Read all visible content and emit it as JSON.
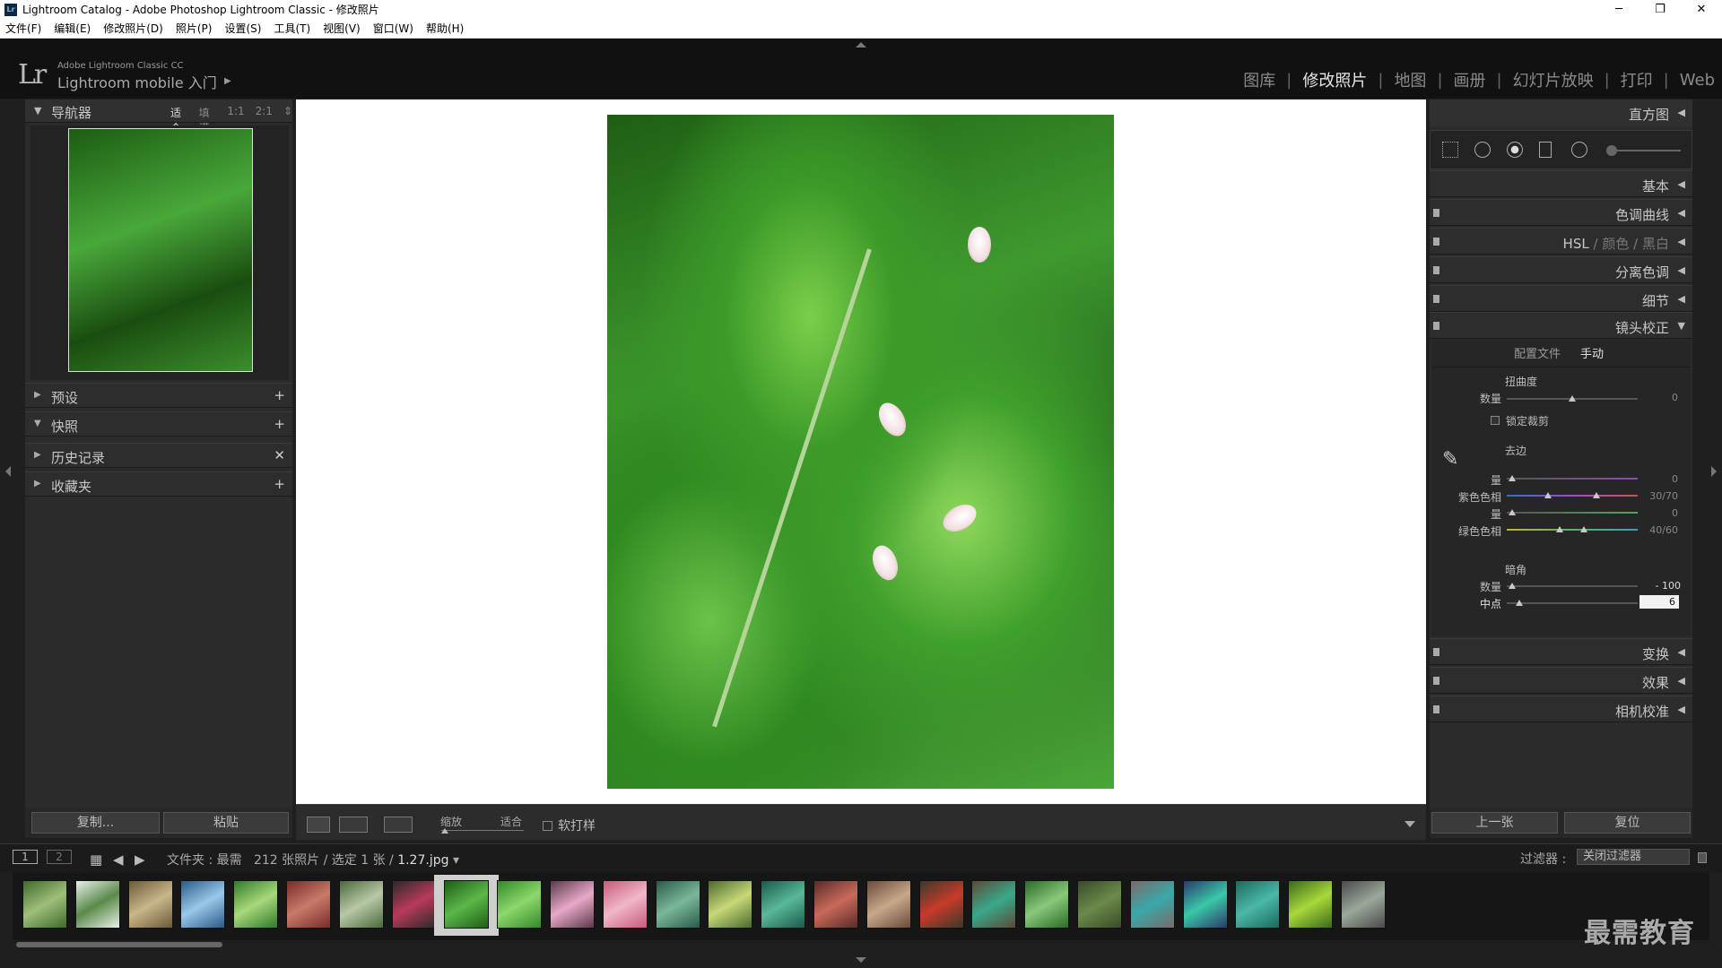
{
  "window": {
    "title": "Lightroom Catalog - Adobe Photoshop Lightroom Classic - 修改照片",
    "app_icon": "Lr",
    "minimize": "─",
    "restore": "❐",
    "close": "✕"
  },
  "menu": [
    "文件(F)",
    "编辑(E)",
    "修改照片(D)",
    "照片(P)",
    "设置(S)",
    "工具(T)",
    "视图(V)",
    "窗口(W)",
    "帮助(H)"
  ],
  "identity": {
    "logo": "Lr",
    "line1": "Adobe Lightroom Classic CC",
    "line2": "Lightroom mobile 入门",
    "arrow": "▶"
  },
  "modules": {
    "items": [
      "图库",
      "修改照片",
      "地图",
      "画册",
      "幻灯片放映",
      "打印",
      "Web"
    ],
    "active": "修改照片",
    "separator": "|"
  },
  "navigator": {
    "title": "导航器",
    "zooms": [
      "适合",
      "填满",
      "1:1",
      "2:1"
    ],
    "zoom_arrows": "⇕"
  },
  "left_panels": [
    {
      "label": "预设",
      "action": "+",
      "tri": "▶"
    },
    {
      "label": "快照",
      "action": "+",
      "tri": "▼"
    },
    {
      "label": "历史记录",
      "action": "✕",
      "tri": "▶"
    },
    {
      "label": "收藏夹",
      "action": "+",
      "tri": "▶"
    }
  ],
  "left_buttons": {
    "copy": "复制...",
    "paste": "粘贴"
  },
  "toolbar": {
    "zoom_label": "缩放",
    "zoom_value": "适合",
    "softproof": "软打样"
  },
  "right": {
    "histogram": "直方图",
    "panels_top": [
      {
        "label": "基本"
      },
      {
        "label": "色调曲线"
      }
    ],
    "hsl": {
      "a": "HSL",
      "b": "颜色",
      "c": "黑白",
      "sep": "/"
    },
    "split_toning": "分离色调",
    "detail": "细节",
    "lens": {
      "title": "镜头校正",
      "tabs": [
        "配置文件",
        "手动"
      ],
      "distortion": {
        "title": "扭曲度",
        "amount_label": "数量",
        "amount": "0",
        "lock_label": "锁定裁剪"
      },
      "defringe": {
        "title": "去边",
        "rows": [
          {
            "label": "量",
            "value": "0"
          },
          {
            "label": "紫色色相",
            "value": "30/70"
          },
          {
            "label": "量",
            "value": "0"
          },
          {
            "label": "绿色色相",
            "value": "40/60"
          }
        ]
      },
      "vignetting": {
        "title": "暗角",
        "amount_label": "数量",
        "amount": "- 100",
        "midpoint_label": "中点",
        "midpoint": "6"
      }
    },
    "panels_bottom": [
      {
        "label": "变换"
      },
      {
        "label": "效果"
      },
      {
        "label": "相机校准"
      }
    ],
    "prev": "上一张",
    "reset": "复位"
  },
  "filmstrip": {
    "screen1": "1",
    "screen2": "2",
    "folder": "文件夹 : 最需",
    "count": "212 张照片 / 选定 1 张 /",
    "filename": "1.27.jpg",
    "filename_arrow": "▾",
    "filter_label": "过滤器 :",
    "filter_value": "关闭过滤器",
    "thumbnail_count": 26,
    "selected_index": 8
  },
  "watermark": "最需教育",
  "colors": {
    "background": "#1f1f1f",
    "panel": "#2b2b2b",
    "active_text": "#e6e6e6"
  }
}
